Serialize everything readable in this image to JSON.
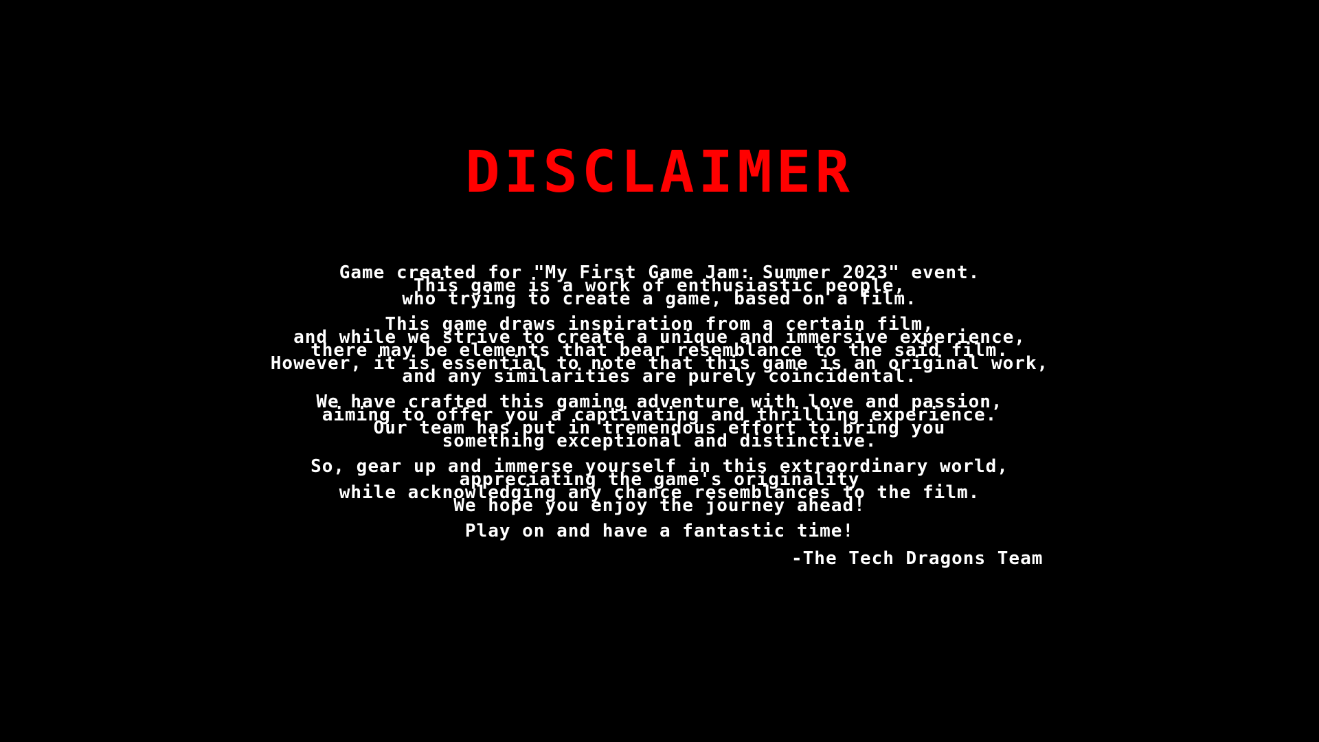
{
  "screen": {
    "background": "#000000",
    "title": "DISCLAIMER",
    "title_color": "#ff0000",
    "text_color": "#ffffff",
    "paragraphs": [
      {
        "lines": [
          "Game created for \"My First Game Jam: Summer 2023\" event.",
          "This game is a work of enthusiastic people,",
          "who trying to create a game, based on a film."
        ]
      },
      {
        "lines": [
          "This game draws inspiration from a certain film,",
          "and while we strive to create a unique and immersive experience,",
          "there may be elements that bear resemblance to the said film.",
          "However, it is essential to note that this game is an original work,",
          "and any similarities are purely coincidental."
        ]
      },
      {
        "lines": [
          "We have crafted this gaming adventure with love and passion,",
          "aiming to offer you a captivating and thrilling experience.",
          "Our team has put in tremendous effort to bring you",
          "something exceptional and distinctive."
        ]
      },
      {
        "lines": [
          "So, gear up and immerse yourself in this extraordinary world,",
          "appreciating the game's originality",
          "while acknowledging any chance resemblances to the film.",
          "We hope you enjoy the journey ahead!"
        ]
      }
    ],
    "closing": "Play on and have a fantastic time!",
    "signature": "-The Tech Dragons Team"
  }
}
